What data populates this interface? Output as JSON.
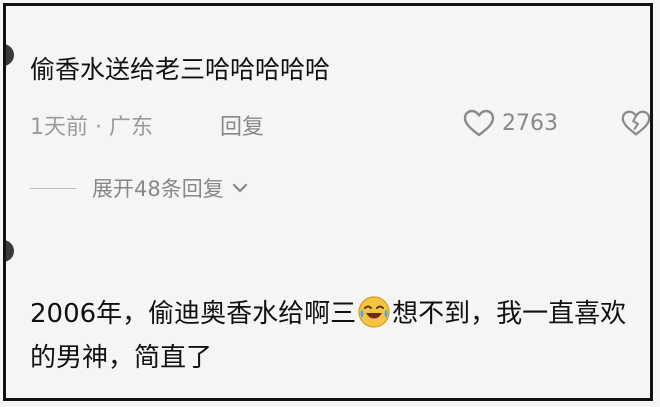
{
  "comment1": {
    "text": "偷香水送给老三哈哈哈哈哈",
    "time_location": "1天前 · 广东",
    "reply_label": "回复",
    "likes": "2763",
    "expand_label": "展开48条回复"
  },
  "comment2": {
    "text_before_emoji": "2006年，偷迪奥香水给啊三",
    "emoji": "laughing-crying-emoji",
    "text_after_emoji": "想不到，我一直喜欢的男神，简直了"
  },
  "icons": {
    "like": "heart-outline-icon",
    "dislike": "broken-heart-icon",
    "expand": "chevron-down-icon"
  },
  "colors": {
    "text_primary": "#111111",
    "text_secondary": "#9a9a9a",
    "background": "#f5f5f5"
  }
}
